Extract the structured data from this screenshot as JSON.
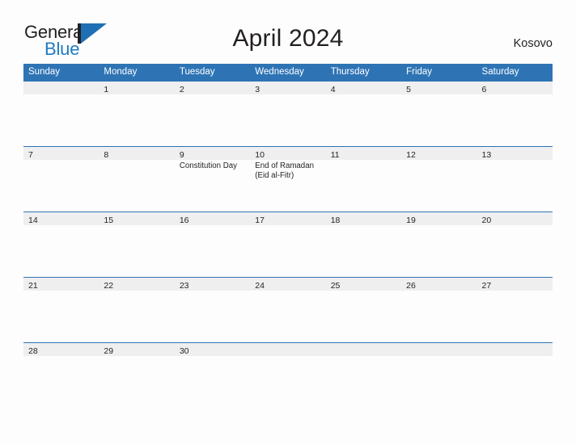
{
  "brand": {
    "name_part1": "General",
    "name_part2": "Blue",
    "logo_icon": "triangle-flag-icon",
    "accent_color": "#2E74B5",
    "dark_color": "#231F20"
  },
  "header": {
    "title": "April 2024",
    "region": "Kosovo"
  },
  "calendar": {
    "weekday_headers": [
      "Sunday",
      "Monday",
      "Tuesday",
      "Wednesday",
      "Thursday",
      "Friday",
      "Saturday"
    ],
    "header_bg": "#2E74B5",
    "daynum_bg": "#EFEFEF",
    "weeks": [
      [
        {
          "day": "",
          "events": []
        },
        {
          "day": "1",
          "events": []
        },
        {
          "day": "2",
          "events": []
        },
        {
          "day": "3",
          "events": []
        },
        {
          "day": "4",
          "events": []
        },
        {
          "day": "5",
          "events": []
        },
        {
          "day": "6",
          "events": []
        }
      ],
      [
        {
          "day": "7",
          "events": []
        },
        {
          "day": "8",
          "events": []
        },
        {
          "day": "9",
          "events": [
            "Constitution Day"
          ]
        },
        {
          "day": "10",
          "events": [
            "End of Ramadan\n(Eid al-Fitr)"
          ]
        },
        {
          "day": "11",
          "events": []
        },
        {
          "day": "12",
          "events": []
        },
        {
          "day": "13",
          "events": []
        }
      ],
      [
        {
          "day": "14",
          "events": []
        },
        {
          "day": "15",
          "events": []
        },
        {
          "day": "16",
          "events": []
        },
        {
          "day": "17",
          "events": []
        },
        {
          "day": "18",
          "events": []
        },
        {
          "day": "19",
          "events": []
        },
        {
          "day": "20",
          "events": []
        }
      ],
      [
        {
          "day": "21",
          "events": []
        },
        {
          "day": "22",
          "events": []
        },
        {
          "day": "23",
          "events": []
        },
        {
          "day": "24",
          "events": []
        },
        {
          "day": "25",
          "events": []
        },
        {
          "day": "26",
          "events": []
        },
        {
          "day": "27",
          "events": []
        }
      ],
      [
        {
          "day": "28",
          "events": []
        },
        {
          "day": "29",
          "events": []
        },
        {
          "day": "30",
          "events": []
        },
        {
          "day": "",
          "events": []
        },
        {
          "day": "",
          "events": []
        },
        {
          "day": "",
          "events": []
        },
        {
          "day": "",
          "events": []
        }
      ]
    ]
  }
}
